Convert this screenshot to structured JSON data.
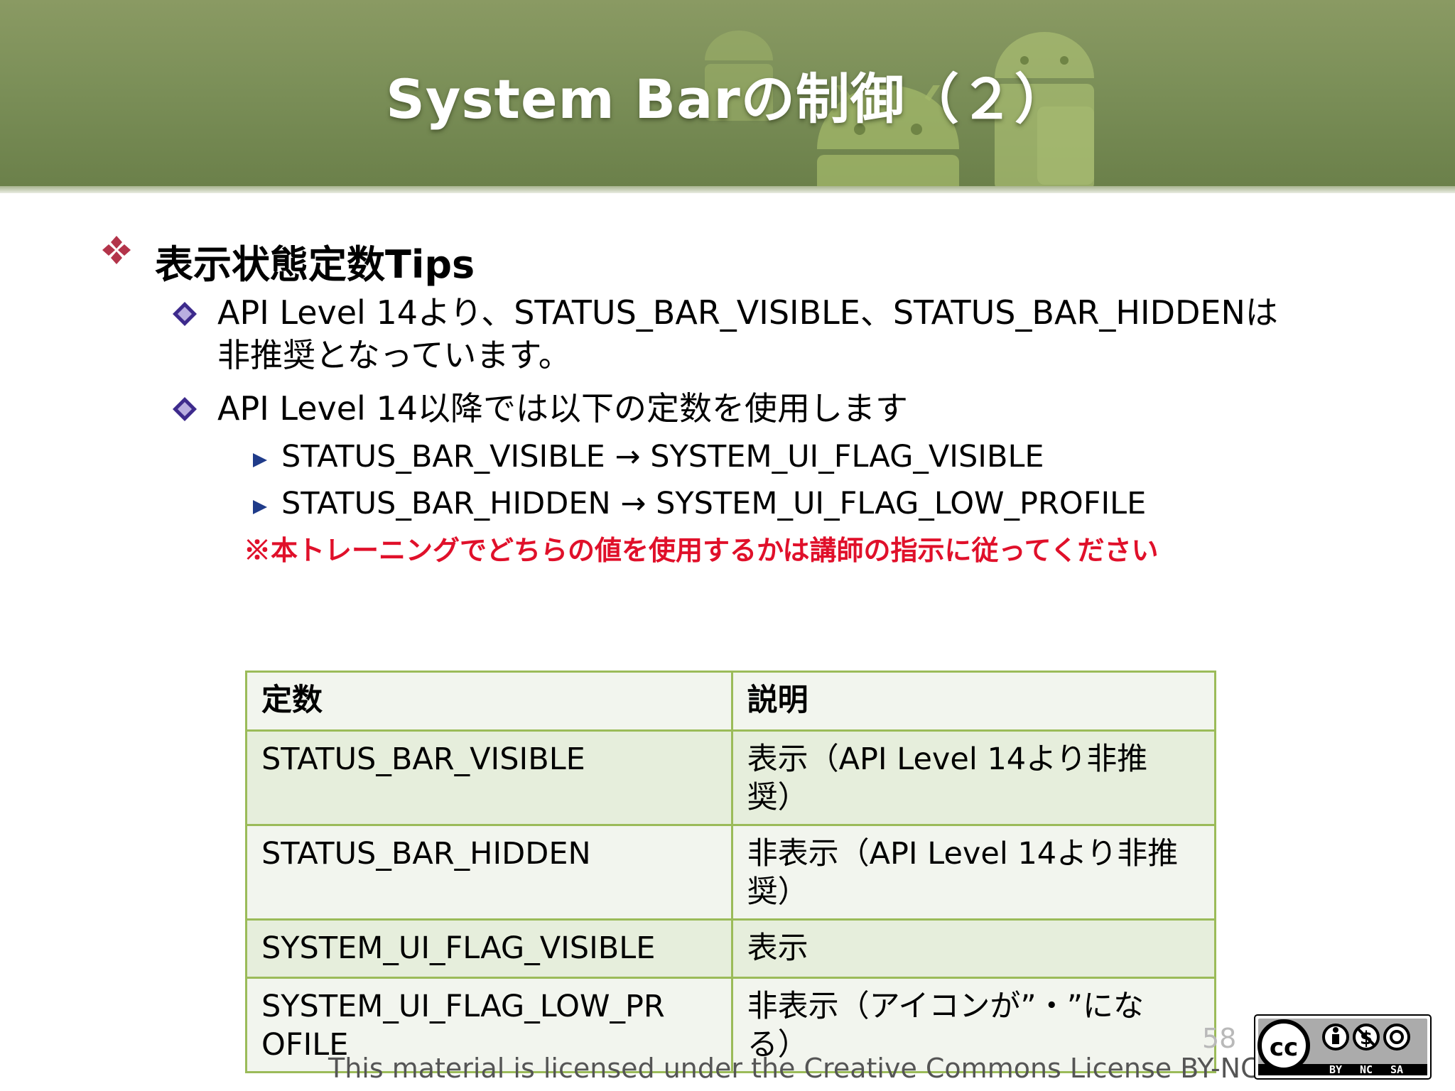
{
  "slide": {
    "title": "System Barの制御（２）",
    "heading": "表示状態定数Tips",
    "points": [
      "API Level 14より、STATUS_BAR_VISIBLE、STATUS_BAR_HIDDENは",
      "非推奨となっています。",
      "API Level 14以降では以下の定数を使用します"
    ],
    "sub_points": [
      "STATUS_BAR_VISIBLE → SYSTEM_UI_FLAG_VISIBLE",
      "STATUS_BAR_HIDDEN → SYSTEM_UI_FLAG_LOW_PROFILE"
    ],
    "note": "※本トレーニングでどちらの値を使用するかは講師の指示に従ってください",
    "note_color": "#e0102a"
  },
  "table": {
    "headers": [
      "定数",
      "説明"
    ],
    "rows": [
      [
        "STATUS_BAR_VISIBLE",
        "表示（API Level 14より非推\n奨）"
      ],
      [
        "STATUS_BAR_HIDDEN",
        "非表示（API Level 14より非推\n奨）"
      ],
      [
        "SYSTEM_UI_FLAG_VISIBLE",
        "表示"
      ],
      [
        "SYSTEM_UI_FLAG_LOW_PR\nOFILE",
        "非表示（アイコンが”・”にな\nる）"
      ]
    ],
    "border_color": "#9bbb59"
  },
  "footer": {
    "page_number": "58",
    "license": "This material is licensed under the Creative Commons License BY-NC-SA 4.0.",
    "cc_badge": {
      "cc": "cc",
      "by": "BY",
      "nc": "NC",
      "sa": "SA"
    }
  }
}
